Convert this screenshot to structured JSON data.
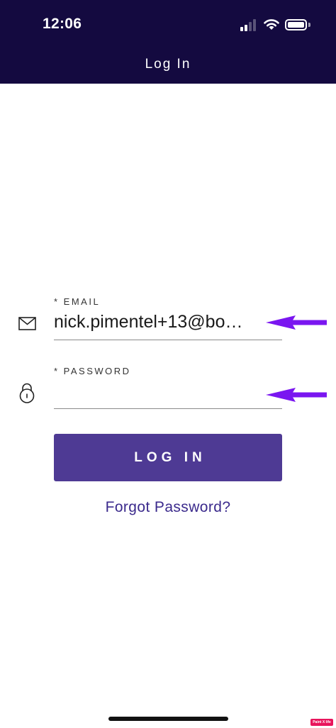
{
  "status_bar": {
    "time": "12:06",
    "signal_icon": "cellular-signal-icon",
    "wifi_icon": "wifi-icon",
    "battery_icon": "battery-icon",
    "battery_level": 1.0
  },
  "header": {
    "title": "Log In",
    "background_color": "#140a40"
  },
  "form": {
    "email": {
      "label": "* EMAIL",
      "value": "nick.pimentel+13@bo…",
      "icon": "envelope-icon"
    },
    "password": {
      "label": "* PASSWORD",
      "value": "",
      "icon": "lock-icon"
    }
  },
  "login_button": {
    "label": "LOG IN",
    "color": "#4e3a94"
  },
  "forgot_password": {
    "label": "Forgot Password?"
  },
  "annotations": {
    "arrow_color": "#7a16f0",
    "arrow_icon": "left-arrow-icon"
  },
  "watermark": {
    "text": "Paint X life"
  }
}
